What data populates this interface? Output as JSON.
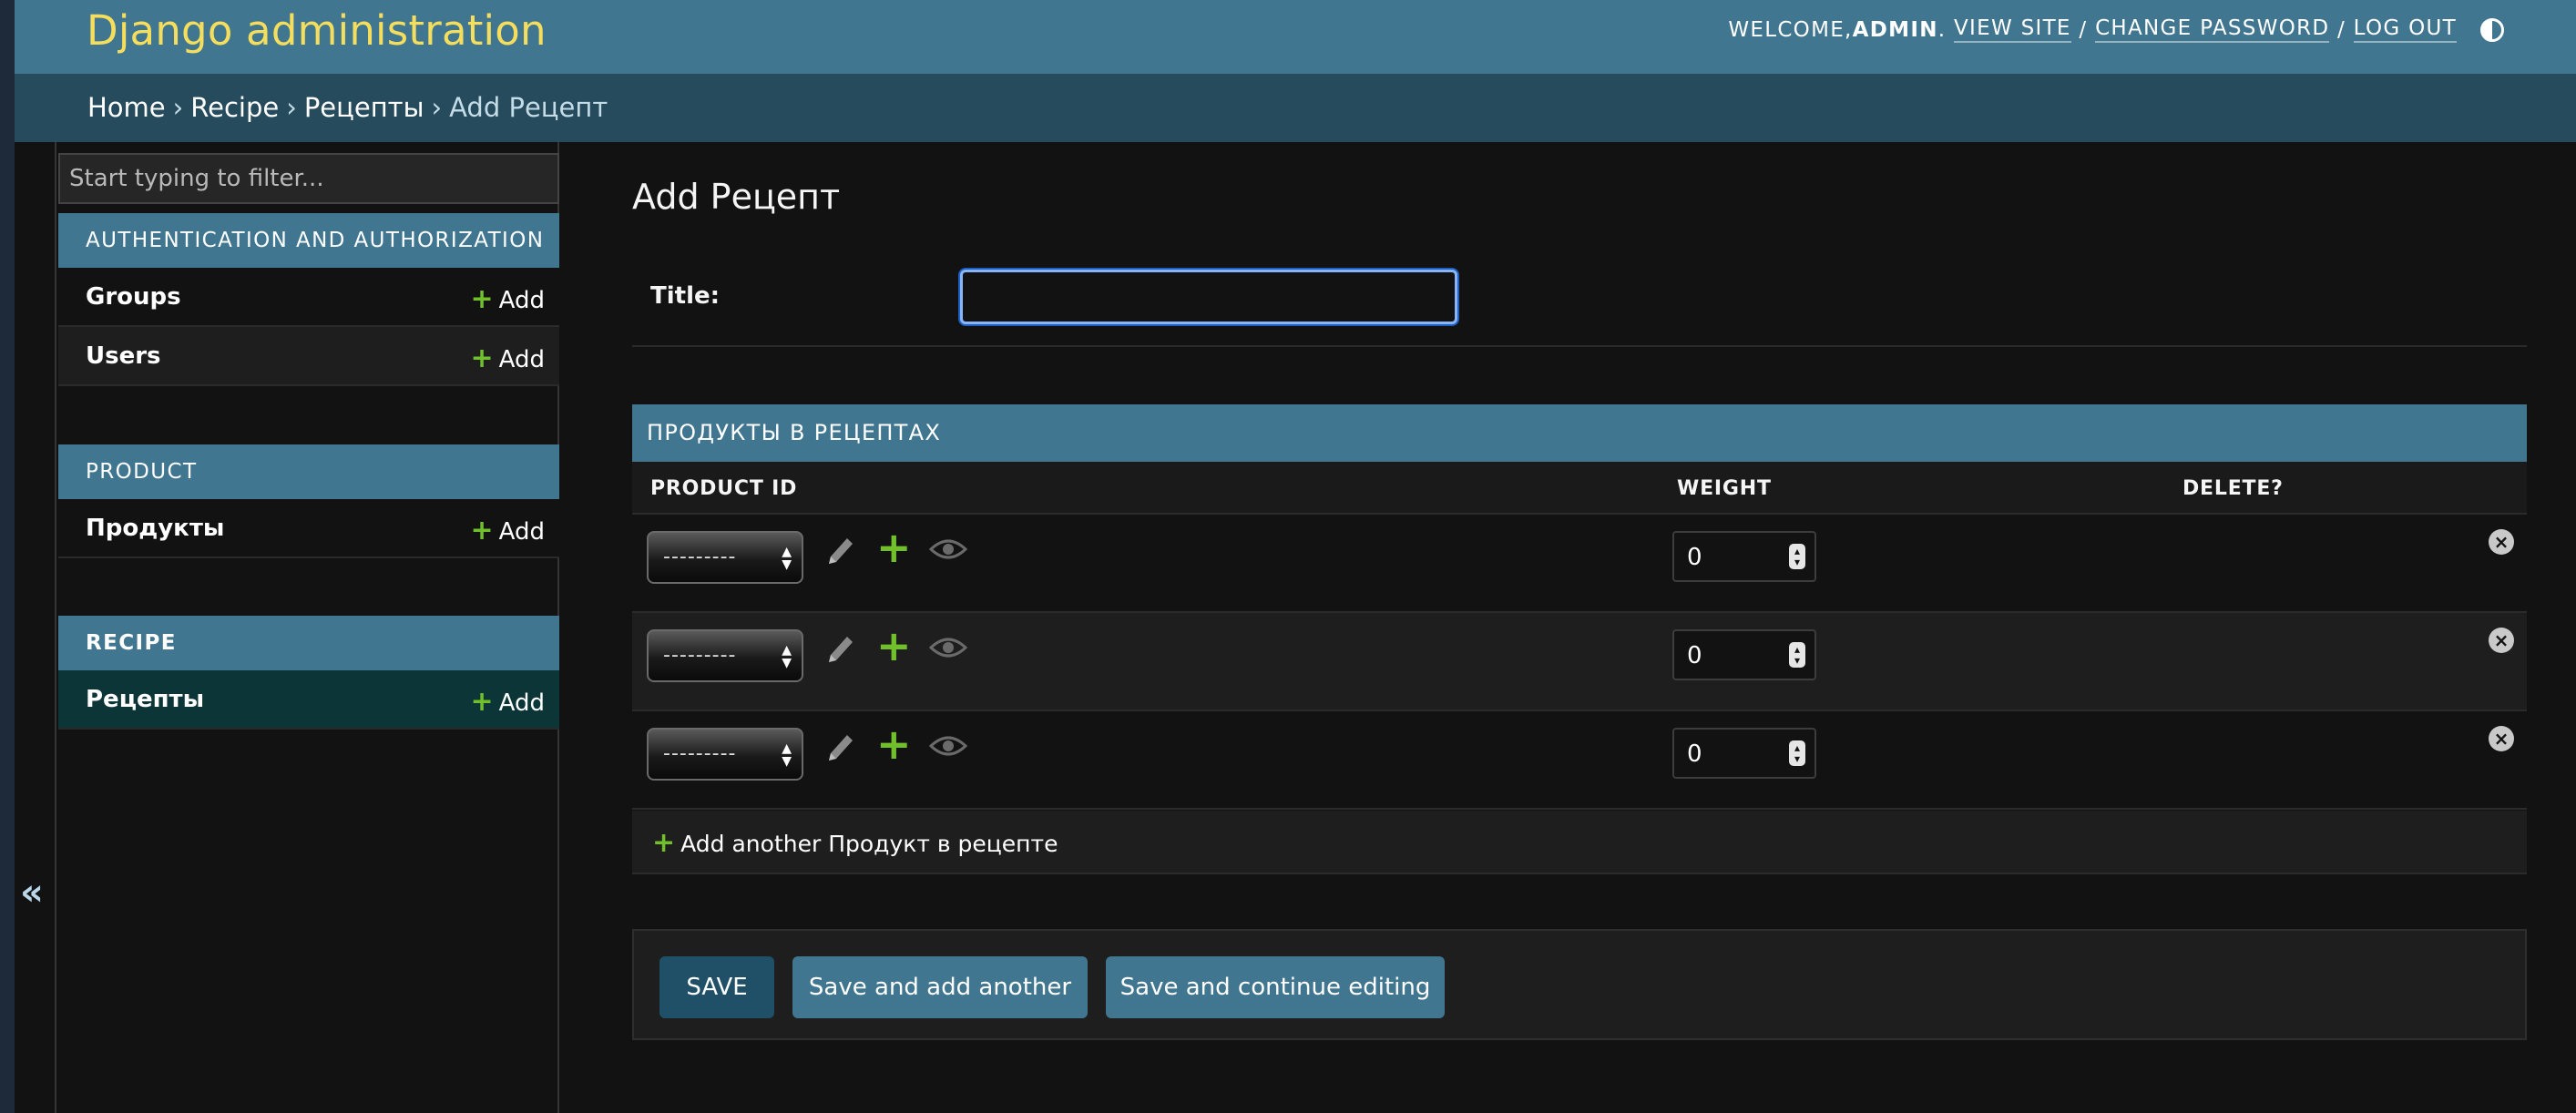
{
  "header": {
    "brand": "Django administration",
    "welcome_prefix": "WELCOME, ",
    "username": "ADMIN",
    "after_user": ". ",
    "view_site": "VIEW SITE",
    "sep1": " / ",
    "change_password": "CHANGE PASSWORD",
    "sep2": " / ",
    "log_out": "LOG OUT",
    "theme_icon": "contrast-icon"
  },
  "breadcrumbs": {
    "items": [
      "Home",
      "Recipe",
      "Рецепты"
    ],
    "separator": "›",
    "current": "Add Рецепт"
  },
  "sidebar": {
    "filter_placeholder": "Start typing to filter...",
    "apps": [
      {
        "caption": "AUTHENTICATION AND AUTHORIZATION",
        "models": [
          {
            "name": "Groups",
            "add": "Add"
          },
          {
            "name": "Users",
            "add": "Add"
          }
        ]
      },
      {
        "caption": "PRODUCT",
        "models": [
          {
            "name": "Продукты",
            "add": "Add"
          }
        ]
      },
      {
        "caption": "RECIPE",
        "models": [
          {
            "name": "Рецепты",
            "add": "Add"
          }
        ]
      }
    ],
    "collapse_glyph": "«"
  },
  "content": {
    "title": "Add Рецепт",
    "fields": {
      "title_label": "Title:",
      "title_value": ""
    },
    "inline": {
      "caption": "ПРОДУКТЫ В РЕЦЕПТАХ",
      "columns": [
        "PRODUCT ID",
        "WEIGHT",
        "DELETE?"
      ],
      "rows": [
        {
          "product": "---------",
          "weight": "0"
        },
        {
          "product": "---------",
          "weight": "0"
        },
        {
          "product": "---------",
          "weight": "0"
        }
      ],
      "add_another": "Add another Продукт в рецепте"
    },
    "buttons": {
      "save": "SAVE",
      "save_add": "Save and add another",
      "save_continue": "Save and continue editing"
    }
  },
  "colors": {
    "header_bg": "#417690",
    "brand": "#f5dd5d",
    "breadcrumbs_bg": "#264b5d",
    "add_green": "#70bf2b",
    "body_bg": "#121212"
  }
}
